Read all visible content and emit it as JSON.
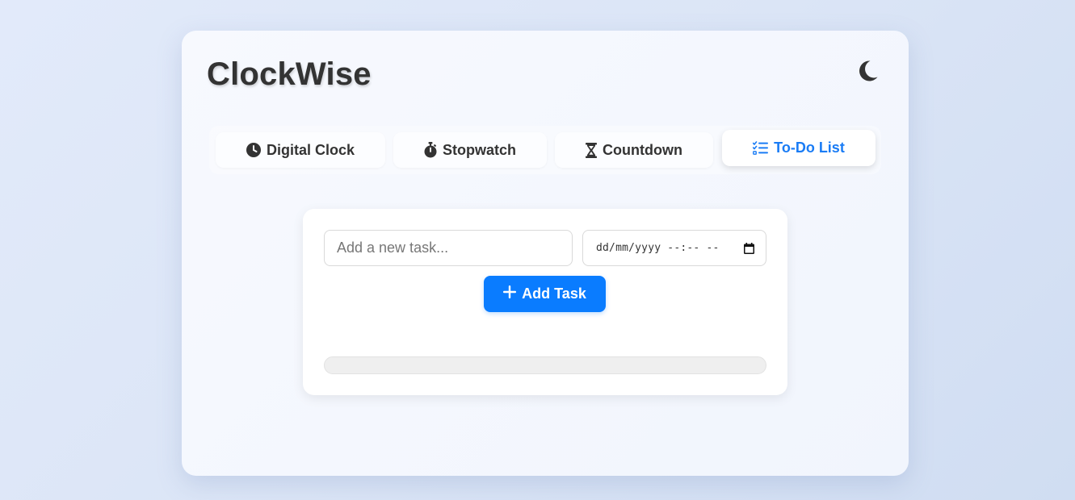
{
  "app": {
    "title": "ClockWise",
    "theme_toggle_icon": "moon-icon"
  },
  "tabs": [
    {
      "label": "Digital Clock",
      "icon": "clock-icon",
      "active": false
    },
    {
      "label": "Stopwatch",
      "icon": "stopwatch-icon",
      "active": false
    },
    {
      "label": "Countdown",
      "icon": "hourglass-icon",
      "active": false
    },
    {
      "label": "To-Do List",
      "icon": "checklist-icon",
      "active": true
    }
  ],
  "todo": {
    "task_input": {
      "placeholder": "Add a new task...",
      "value": ""
    },
    "due_date_input": {
      "display": "dd/mm/yyyy --:-- --",
      "icon": "calendar-icon"
    },
    "add_button": {
      "label": "Add Task",
      "icon": "plus-icon"
    },
    "progress": {
      "fraction": 0
    }
  },
  "colors": {
    "accent": "#0a7cff",
    "active_tab_text": "#1a7cf5",
    "text_primary": "#333333"
  }
}
